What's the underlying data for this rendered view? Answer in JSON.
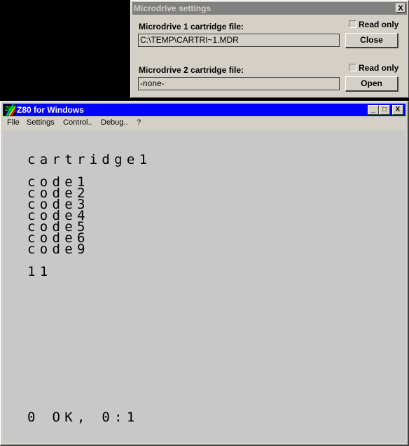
{
  "dialog": {
    "title": "Microdrive settings",
    "close_glyph": "X",
    "drive1": {
      "label": "Microdrive 1 cartridge file:",
      "file": "C:\\TEMP\\CARTRI~1.MDR",
      "read_only_label": "Read only",
      "read_only": false,
      "button": "Close"
    },
    "drive2": {
      "label": "Microdrive 2 cartridge file:",
      "file": "-none-",
      "read_only_label": "Read only",
      "read_only": false,
      "button": "Open"
    }
  },
  "window": {
    "title": "Z80 for Windows",
    "minimize_glyph": "_",
    "maximize_glyph": "□",
    "close_glyph": "X",
    "menu": [
      "File",
      "Settings",
      "Control..",
      "Debug..",
      "?"
    ]
  },
  "screen": {
    "lines": [
      "cartridge1",
      "",
      "code1",
      "code2",
      "code3",
      "code4",
      "code5",
      "code6",
      "code9",
      "",
      "11"
    ],
    "status": "0 OK, 0:1"
  },
  "colors": {
    "titlebar_active": "#0000ff",
    "titlebar_inactive": "#808080",
    "face": "#d4d0c8",
    "screen_bg": "#c8c8c8"
  }
}
